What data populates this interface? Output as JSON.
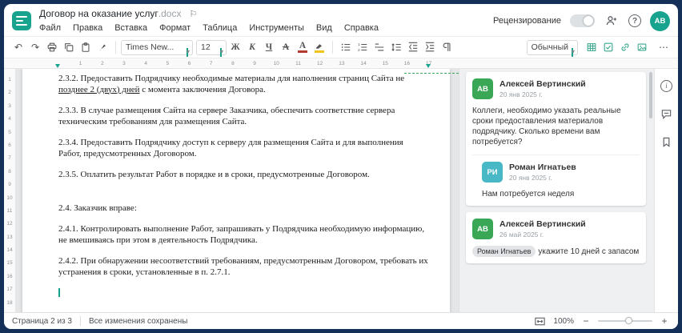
{
  "window": {
    "title": "Договор на оказание услуг",
    "title_ext": ".docx"
  },
  "menubar": {
    "items": [
      "Файл",
      "Правка",
      "Вставка",
      "Формат",
      "Таблица",
      "Инструменты",
      "Вид",
      "Справка"
    ]
  },
  "header": {
    "review_label": "Рецензирование",
    "user_initials": "АВ"
  },
  "toolbar": {
    "font_name": "Times New...",
    "font_size": "12",
    "bold": "Ж",
    "italic": "К",
    "underline": "Ч",
    "strikethrough": "А",
    "font_color": "А",
    "style_name": "Обычный"
  },
  "rulers": {
    "horizontal": [
      "1",
      "2",
      "3",
      "4",
      "5",
      "6",
      "7",
      "8",
      "9",
      "10",
      "11",
      "12",
      "13",
      "14",
      "15",
      "16",
      "17"
    ],
    "vertical": [
      "1",
      "2",
      "3",
      "4",
      "5",
      "6",
      "7",
      "8",
      "9",
      "10",
      "11",
      "12",
      "13",
      "14",
      "15",
      "16",
      "17",
      "18"
    ]
  },
  "document": {
    "p1_before": "2.3.2. Предоставить Подрядчику необходимые материалы для наполнения страниц Сайта не ",
    "p1_inserted": "позднее 2 (двух) дней",
    "p1_after": " с момента заключения Договора.",
    "p2": "2.3.3. В случае размещения Сайта на сервере Заказчика, обеспечить соответствие сервера техническим требованиям для размещения Сайта.",
    "p3": "2.3.4. Предоставить Подрядчику доступ к серверу для размещения Сайта и для выполнения Работ, предусмотренных Договором.",
    "p4": "2.3.5. Оплатить результат Работ в порядке и в сроки, предусмотренные Договором.",
    "p5": "2.4. Заказчик вправе:",
    "p6": "2.4.1. Контролировать выполнение Работ, запрашивать у Подрядчика необходимую информацию, не вмешиваясь при этом в деятельность Подрядчика.",
    "p7": "2.4.2. При обнаружении несоответствий требованиям, предусмотренным Договором, требовать их устранения в сроки, установленные в п. 2.7.1."
  },
  "comments": [
    {
      "initials": "АВ",
      "author": "Алексей Вертинский",
      "date": "20 янв 2025 г.",
      "text": "Коллеги, необходимо указать реальные сроки предоставления материалов подрядчику. Сколько времени вам потребуется?",
      "reply": {
        "initials": "РИ",
        "author": "Роман Игнатьев",
        "date": "20 янв 2025 г.",
        "text": "Нам потребуется неделя"
      }
    },
    {
      "initials": "АВ",
      "author": "Алексей Вертинский",
      "date": "26 май 2025 г.",
      "mention": "Роман Игнатьев",
      "text": "укажите 10 дней с запасом"
    }
  ],
  "statusbar": {
    "page_info": "Страница 2 из 3",
    "save_status": "Все изменения сохранены",
    "zoom": "100%"
  },
  "icons": {
    "undo": "↶",
    "redo": "↷",
    "flag": "⚐",
    "dropdown": "▾",
    "help": "?",
    "more": "⋯",
    "minus": "−",
    "plus": "+",
    "info": "i"
  }
}
